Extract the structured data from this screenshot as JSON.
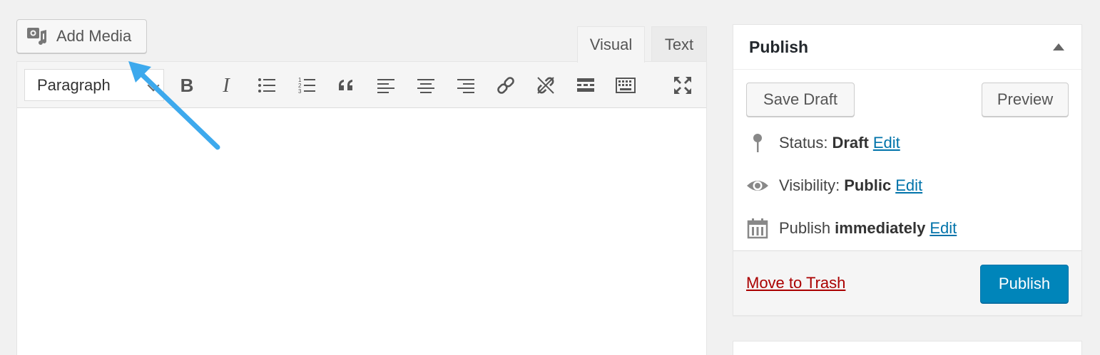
{
  "media": {
    "add_label": "Add Media"
  },
  "editor": {
    "tabs": [
      {
        "label": "Visual",
        "active": true
      },
      {
        "label": "Text",
        "active": false
      }
    ],
    "format_selected": "Paragraph",
    "toolbar_icons": [
      "bold-icon",
      "italic-icon",
      "bulleted-list-icon",
      "numbered-list-icon",
      "blockquote-icon",
      "align-left-icon",
      "align-center-icon",
      "align-right-icon",
      "insert-link-icon",
      "remove-link-icon",
      "read-more-icon",
      "toolbar-toggle-icon",
      "fullscreen-icon"
    ]
  },
  "publish": {
    "title": "Publish",
    "save_draft_label": "Save Draft",
    "preview_label": "Preview",
    "status": {
      "label": "Status:",
      "value": "Draft",
      "edit": "Edit"
    },
    "visibility": {
      "label": "Visibility:",
      "value": "Public",
      "edit": "Edit"
    },
    "schedule": {
      "label": "Publish",
      "value": "immediately",
      "edit": "Edit"
    },
    "trash_label": "Move to Trash",
    "publish_label": "Publish"
  },
  "colors": {
    "primary": "#0085ba",
    "link": "#0073aa",
    "trash": "#aa0000",
    "arrow": "#3da9ed"
  }
}
